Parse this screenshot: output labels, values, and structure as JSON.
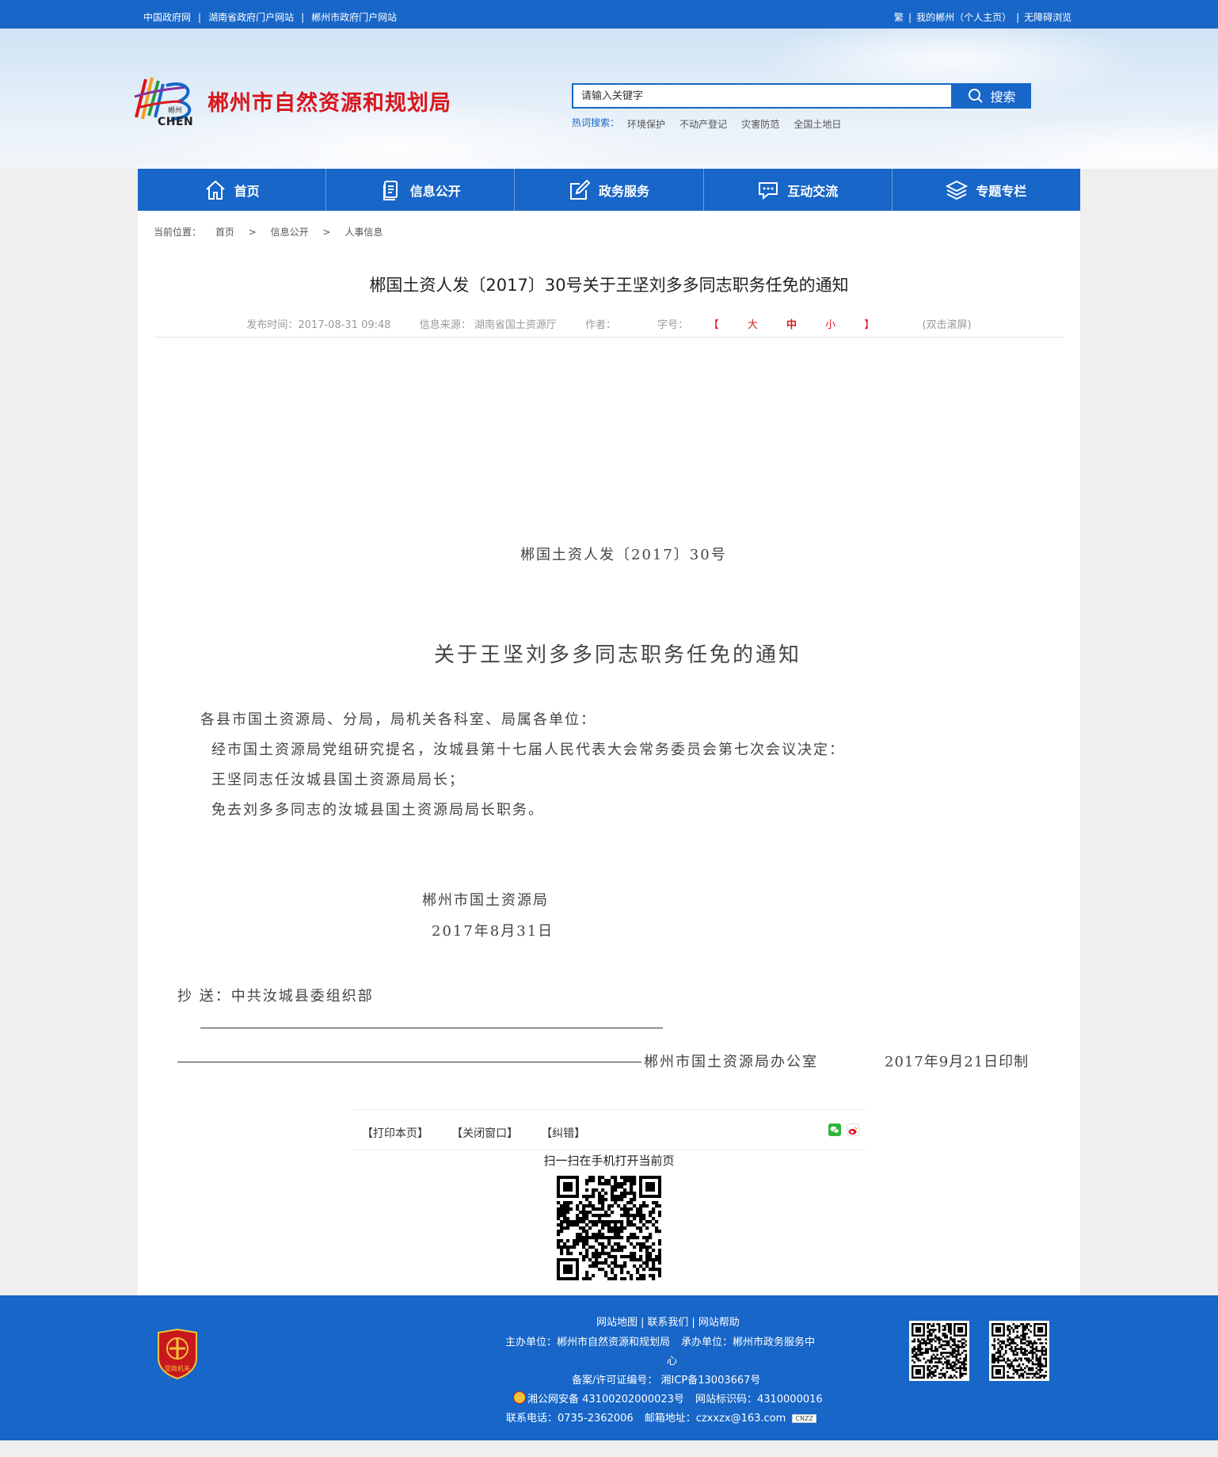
{
  "topbar": {
    "left_links": [
      "中国政府网",
      "湖南省政府门户网站",
      "郴州市政府门户网站"
    ],
    "right_links": [
      "繁",
      "我的郴州（个人主页）",
      "无障碍浏览"
    ]
  },
  "header": {
    "logo_text": "CHEN",
    "logo_small": "郴州",
    "site_title": "郴州市自然资源和规划局",
    "search_placeholder": "请输入关键字",
    "search_button": "搜索",
    "hot_label": "热词搜索：",
    "hot_words": [
      "环境保护",
      "不动产登记",
      "灾害防范",
      "全国土地日"
    ]
  },
  "nav": [
    {
      "label": "首页",
      "icon": "home-icon"
    },
    {
      "label": "信息公开",
      "icon": "document-icon"
    },
    {
      "label": "政务服务",
      "icon": "edit-icon"
    },
    {
      "label": "互动交流",
      "icon": "chat-icon"
    },
    {
      "label": "专题专栏",
      "icon": "layers-icon"
    }
  ],
  "breadcrumb": {
    "label": "当前位置：",
    "items": [
      "首页",
      "信息公开",
      "人事信息"
    ],
    "separator": ">"
  },
  "article": {
    "title": "郴国土资人发〔2017〕30号关于王坚刘多多同志职务任免的通知",
    "publish_time": "发布时间：2017-08-31 09:48",
    "source": "信息来源： 湖南省国土资源厅",
    "author": "作者：",
    "font_size_label": "字号：",
    "font_size_open": "【",
    "font_large": "大",
    "font_medium": "中",
    "font_small": "小",
    "font_size_close": "】",
    "scroll_hint": "(双击滚屏)",
    "doc_number": "郴国土资人发〔2017〕30号",
    "doc_title": "关于王坚刘多多同志职务任免的通知",
    "salutation": "各县市国土资源局、分局，局机关各科室、局属各单位：",
    "body": [
      "经市国土资源局党组研究提名，汝城县第十七届人民代表大会常务委员会第七次会议决定：",
      "王坚同志任汝城县国土资源局局长；",
      "免去刘多多同志的汝城县国土资源局局长职务。"
    ],
    "signature_org": "郴州市国土资源局",
    "signature_date": "2017年8月31日",
    "cc": "抄  送：中共汝城县委组织部",
    "printer": "郴州市国土资源局办公室",
    "print_date": "2017年9月21日印制"
  },
  "tools": {
    "print": "【打印本页】",
    "close": "【关闭窗口】",
    "correct": "【纠错】",
    "scan_text": "扫一扫在手机打开当前页"
  },
  "footer": {
    "links": [
      "网站地图",
      "联系我们",
      "网站帮助"
    ],
    "sponsor": "主办单位：郴州市自然资源和规划局",
    "undertaker": "承办单位：郴州市政务服务中",
    "undertaker_wrap": "心",
    "icp": "备案/许可证编号： 湘ICP备13003667号",
    "police": "湘公网安备 43100202000023号",
    "site_code": "网站标识码：4310000016",
    "phone": "联系电话：0735-2362006",
    "email": "邮箱地址：czxxzx@163.com",
    "badge_text": "党政机关",
    "cnzz": "CNZZ"
  },
  "colors": {
    "brand_blue": "#1766c8",
    "title_red": "#d8171d"
  }
}
